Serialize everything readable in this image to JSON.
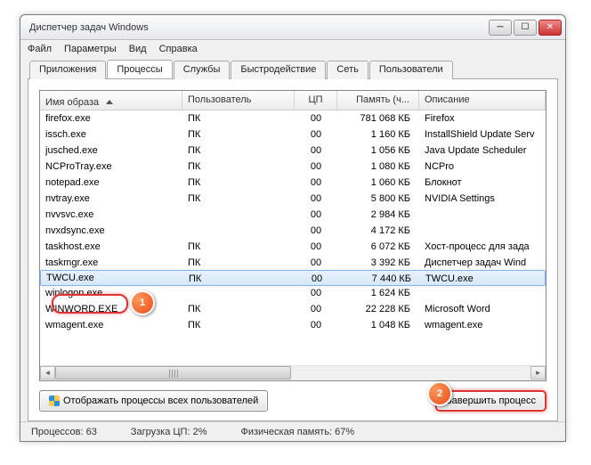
{
  "title": "Диспетчер задач Windows",
  "menu": {
    "file": "Файл",
    "options": "Параметры",
    "view": "Вид",
    "help": "Справка"
  },
  "tabs": {
    "apps": "Приложения",
    "processes": "Процессы",
    "services": "Службы",
    "performance": "Быстродействие",
    "network": "Сеть",
    "users": "Пользователи"
  },
  "columns": {
    "image": "Имя образа",
    "user": "Пользователь",
    "cpu": "ЦП",
    "mem": "Память (ч...",
    "desc": "Описание"
  },
  "rows": [
    {
      "img": "firefox.exe",
      "user": "ПК",
      "cpu": "00",
      "mem": "781 068 КБ",
      "desc": "Firefox"
    },
    {
      "img": "issch.exe",
      "user": "ПК",
      "cpu": "00",
      "mem": "1 160 КБ",
      "desc": "InstallShield Update Serv"
    },
    {
      "img": "jusched.exe",
      "user": "ПК",
      "cpu": "00",
      "mem": "1 056 КБ",
      "desc": "Java Update Scheduler"
    },
    {
      "img": "NCProTray.exe",
      "user": "ПК",
      "cpu": "00",
      "mem": "1 080 КБ",
      "desc": "NCPro"
    },
    {
      "img": "notepad.exe",
      "user": "ПК",
      "cpu": "00",
      "mem": "1 060 КБ",
      "desc": "Блокнот"
    },
    {
      "img": "nvtray.exe",
      "user": "ПК",
      "cpu": "00",
      "mem": "5 800 КБ",
      "desc": "NVIDIA Settings"
    },
    {
      "img": "nvvsvc.exe",
      "user": "",
      "cpu": "00",
      "mem": "2 984 КБ",
      "desc": ""
    },
    {
      "img": "nvxdsync.exe",
      "user": "",
      "cpu": "00",
      "mem": "4 172 КБ",
      "desc": ""
    },
    {
      "img": "taskhost.exe",
      "user": "ПК",
      "cpu": "00",
      "mem": "6 072 КБ",
      "desc": "Хост-процесс для зада"
    },
    {
      "img": "taskmgr.exe",
      "user": "ПК",
      "cpu": "00",
      "mem": "3 392 КБ",
      "desc": "Диспетчер задач Wind"
    },
    {
      "img": "TWCU.exe",
      "user": "ПК",
      "cpu": "00",
      "mem": "7 440 КБ",
      "desc": "TWCU.exe"
    },
    {
      "img": "winlogon.exe",
      "user": "",
      "cpu": "00",
      "mem": "1 624 КБ",
      "desc": ""
    },
    {
      "img": "WINWORD.EXE",
      "user": "ПК",
      "cpu": "00",
      "mem": "22 228 КБ",
      "desc": "Microsoft Word"
    },
    {
      "img": "wmagent.exe",
      "user": "ПК",
      "cpu": "00",
      "mem": "1 048 КБ",
      "desc": "wmagent.exe"
    }
  ],
  "selected_index": 10,
  "buttons": {
    "show_all": "Отображать процессы всех пользователей",
    "end_process": "Завершить процесс"
  },
  "status": {
    "processes": "Процессов: 63",
    "cpu": "Загрузка ЦП: 2%",
    "mem": "Физическая память: 67%"
  },
  "markers": {
    "one": "1",
    "two": "2"
  }
}
